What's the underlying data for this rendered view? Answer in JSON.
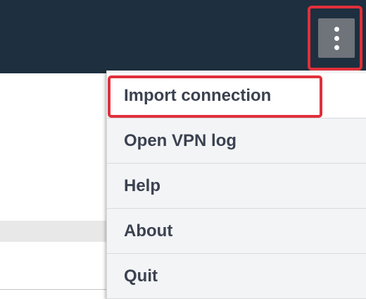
{
  "colors": {
    "top_bar": "#1e2f3f",
    "highlight": "#e0303a",
    "menu_background": "#f3f4f6",
    "menu_text": "#3b4250"
  },
  "toolbar": {
    "menu_icon": "kebab-vertical-icon"
  },
  "menu": {
    "items": [
      {
        "label": "Import connection"
      },
      {
        "label": "Open VPN log"
      },
      {
        "label": "Help"
      },
      {
        "label": "About"
      },
      {
        "label": "Quit"
      }
    ]
  }
}
